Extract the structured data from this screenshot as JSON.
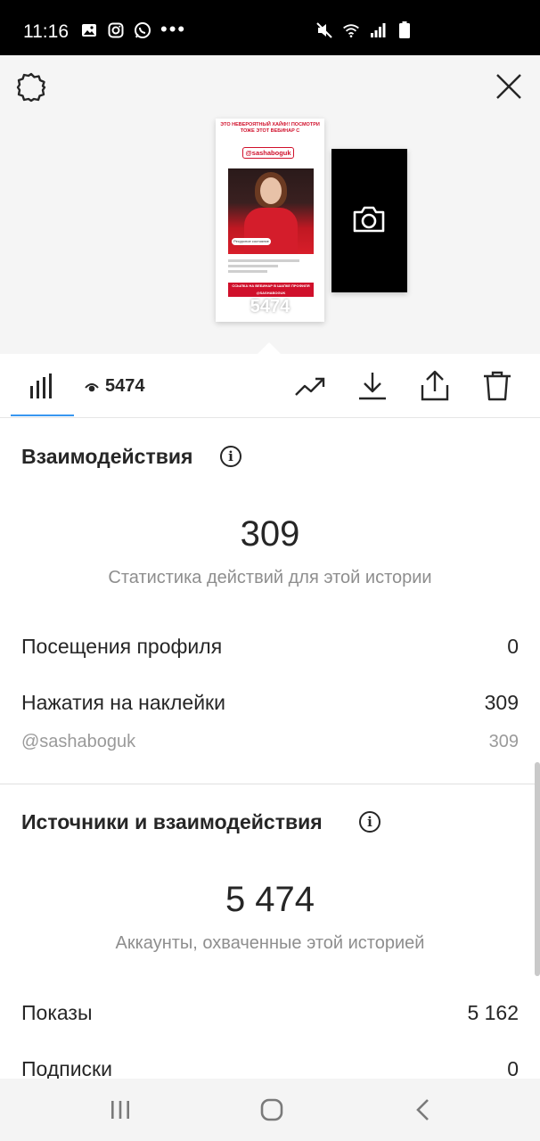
{
  "status_bar": {
    "time": "11:16",
    "left_icons": [
      "gallery-icon",
      "instagram-icon",
      "whatsapp-icon",
      "more-dots-icon"
    ],
    "right_icons": [
      "mute-icon",
      "wifi-icon",
      "signal-icon",
      "battery-icon"
    ],
    "dots": "•••"
  },
  "preview": {
    "story_header": "ЭТО НЕВЕРОЯТНЫЙ ХАЙФ!! ПОСМОТРИ ТОЖЕ ЭТОТ ВЕБИНАР С",
    "story_mention": "@sashaboguk",
    "story_sticker": "Ресурсное состояние",
    "story_banner": "ССЫЛКА НА ВЕБИНАР В ШАПКЕ ПРОФИЛЯ @SASHABOGUK",
    "story_views": "5474"
  },
  "toolbar": {
    "views": "5474"
  },
  "interactions": {
    "title": "Взаимодействия",
    "total": "309",
    "subtitle": "Статистика действий для этой истории",
    "rows": [
      {
        "label": "Посещения профиля",
        "value": "0"
      },
      {
        "label": "Нажатия на наклейки",
        "value": "309"
      }
    ],
    "sub_row": {
      "label": "@sashaboguk",
      "value": "309"
    }
  },
  "discovery": {
    "title": "Источники и взаимодействия",
    "total": "5 474",
    "subtitle": "Аккаунты, охваченные этой историей",
    "rows": [
      {
        "label": "Показы",
        "value": "5 162"
      },
      {
        "label": "Подписки",
        "value": "0"
      }
    ]
  },
  "colors": {
    "accent": "#3897f0",
    "brand_red": "#d0102b",
    "muted_text": "#8e8e8e"
  }
}
